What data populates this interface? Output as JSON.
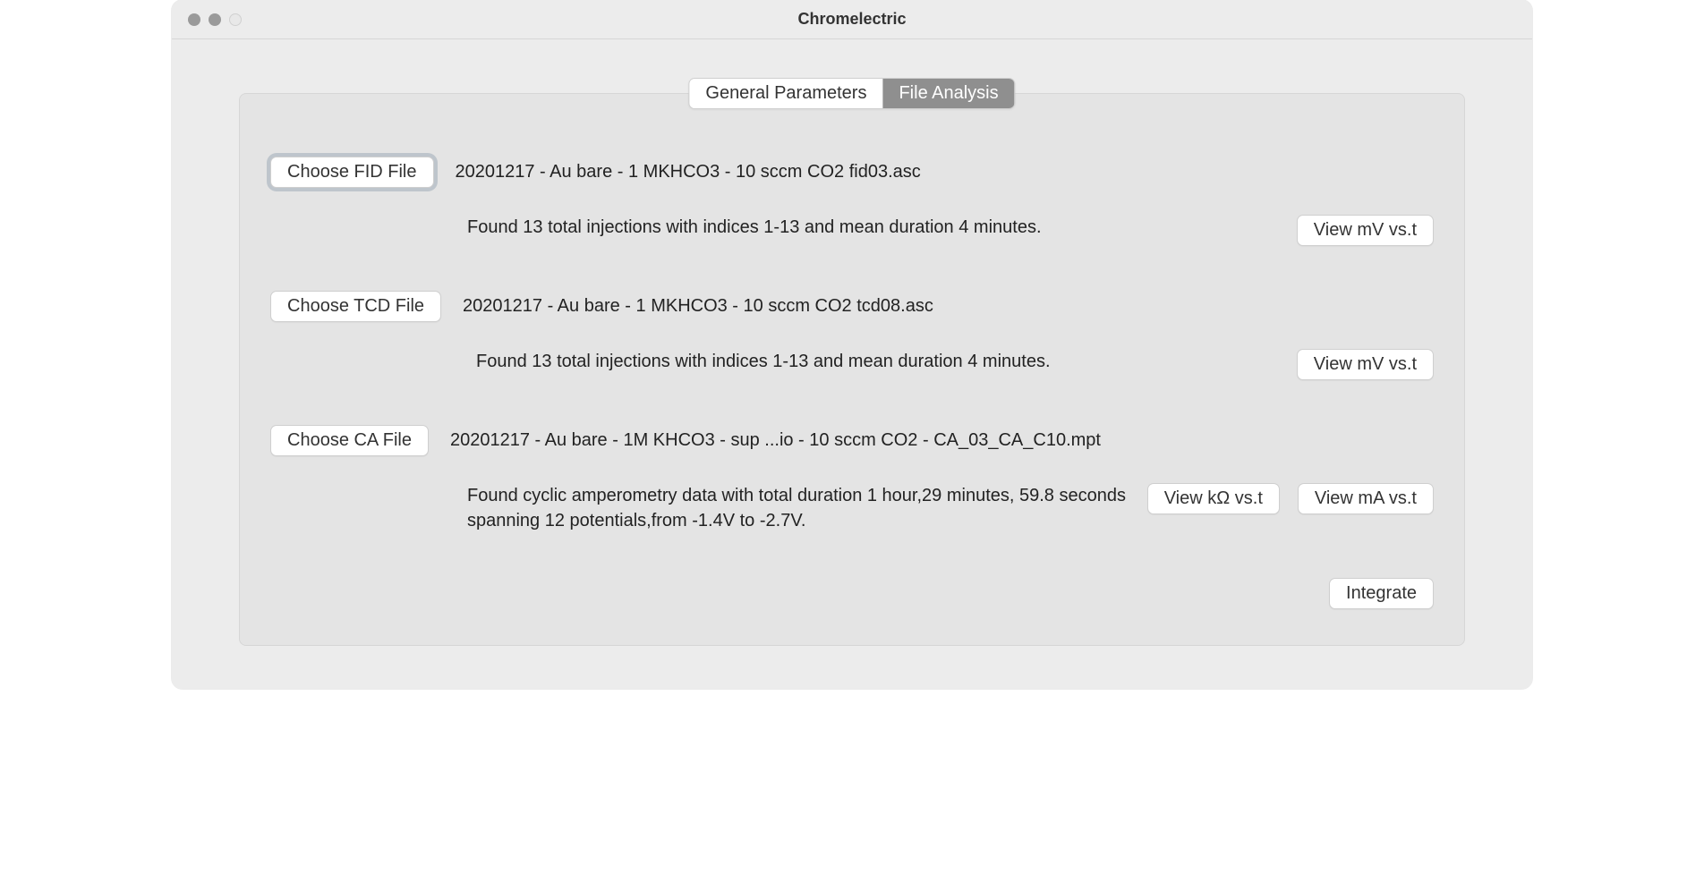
{
  "window": {
    "title": "Chromelectric"
  },
  "tabs": {
    "general": "General Parameters",
    "file_analysis": "File Analysis"
  },
  "fid": {
    "choose_label": "Choose FID File",
    "file_name": "20201217 - Au bare - 1 MKHCO3 - 10 sccm CO2 fid03.asc",
    "status": "Found 13 total injections with indices 1-13 and mean duration 4 minutes.",
    "view_label": "View mV vs.t"
  },
  "tcd": {
    "choose_label": "Choose TCD File",
    "file_name": "20201217 - Au bare - 1 MKHCO3 - 10 sccm CO2 tcd08.asc",
    "status": "Found 13 total injections with indices 1-13 and mean duration 4 minutes.",
    "view_label": "View mV vs.t"
  },
  "ca": {
    "choose_label": "Choose CA File",
    "file_name": "20201217 - Au bare - 1M KHCO3 - sup ...io - 10 sccm CO2 - CA_03_CA_C10.mpt",
    "status": "Found cyclic amperometry data with total duration 1 hour,29 minutes, 59.8 seconds spanning 12 potentials,from -1.4V to -2.7V.",
    "view_kohm_label": "View kΩ vs.t",
    "view_ma_label": "View mA vs.t"
  },
  "integrate_label": "Integrate"
}
